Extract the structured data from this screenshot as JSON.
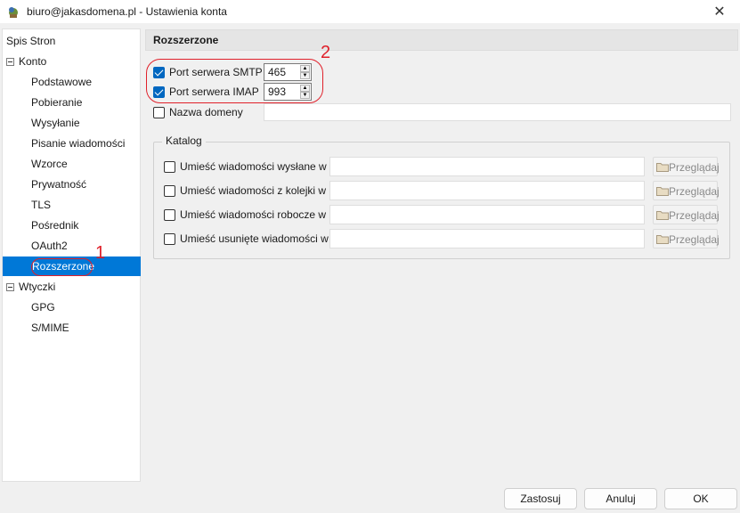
{
  "window": {
    "title": "biuro@jakasdomena.pl - Ustawienia konta",
    "close_glyph": "✕"
  },
  "sidebar": {
    "root": "Spis Stron",
    "groups": [
      {
        "label": "Konto",
        "toggle": "minus",
        "items": [
          "Podstawowe",
          "Pobieranie",
          "Wysyłanie",
          "Pisanie wiadomości",
          "Wzorce",
          "Prywatność",
          "TLS",
          "Pośrednik",
          "OAuth2",
          "Rozszerzone"
        ]
      },
      {
        "label": "Wtyczki",
        "toggle": "minus",
        "items": [
          "GPG",
          "S/MIME"
        ]
      }
    ],
    "selected": "Rozszerzone",
    "selected_color": "#0078d7"
  },
  "annotations": {
    "marker_1": "1",
    "marker_2": "2",
    "color": "#e0202a"
  },
  "panel": {
    "title": "Rozszerzone",
    "smtp": {
      "label": "Port serwera SMTP",
      "checked": true,
      "value": "465"
    },
    "imap": {
      "label": "Port serwera IMAP",
      "checked": true,
      "value": "993"
    },
    "domain": {
      "label": "Nazwa domeny",
      "checked": false,
      "value": ""
    },
    "catalog": {
      "title": "Katalog",
      "rows": [
        {
          "label": "Umieść wiadomości wysłane w",
          "checked": false,
          "value": "",
          "button": "Przeglądaj"
        },
        {
          "label": "Umieść wiadomości z kolejki w",
          "checked": false,
          "value": "",
          "button": "Przeglądaj"
        },
        {
          "label": "Umieść wiadomości robocze w",
          "checked": false,
          "value": "",
          "button": "Przeglądaj"
        },
        {
          "label": "Umieść usunięte wiadomości w",
          "checked": false,
          "value": "",
          "button": "Przeglądaj"
        }
      ]
    }
  },
  "footer": {
    "apply": "Zastosuj",
    "cancel": "Anuluj",
    "ok": "OK"
  },
  "icons": {
    "app": "app-icon",
    "folder": "folder-icon",
    "spin_up": "▲",
    "spin_down": "▼"
  }
}
